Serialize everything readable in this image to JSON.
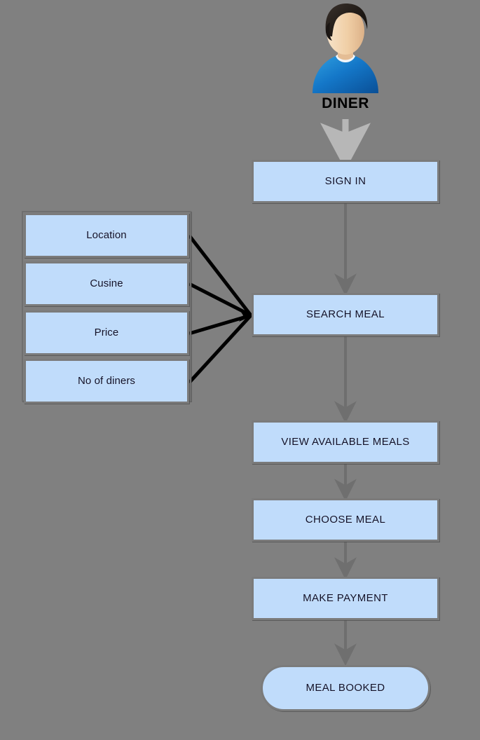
{
  "diagram": {
    "title": "DINER meal booking flowchart",
    "background_color": "#808080",
    "node_fill_color": "#c0dcfb",
    "node_border_color": "#7b7b7b",
    "connector_color": "#6f6f6f",
    "criteria_connector_color": "#000000",
    "actor": {
      "icon": "user-avatar-icon",
      "label": "DINER",
      "hair_color": "#211c19",
      "skin_color": "#f2d2ae",
      "shirt_color": "#1477c8"
    },
    "main_flow": [
      {
        "id": "sign-in",
        "label": "SIGN IN",
        "shape": "rect"
      },
      {
        "id": "search-meal",
        "label": "SEARCH MEAL",
        "shape": "rect"
      },
      {
        "id": "view-available-meals",
        "label": "VIEW AVAILABLE MEALS",
        "shape": "rect"
      },
      {
        "id": "choose-meal",
        "label": "CHOOSE MEAL",
        "shape": "rect"
      },
      {
        "id": "make-payment",
        "label": "MAKE PAYMENT",
        "shape": "rect"
      },
      {
        "id": "meal-booked",
        "label": "MEAL BOOKED",
        "shape": "terminator"
      }
    ],
    "search_criteria": [
      {
        "id": "location",
        "label": "Location"
      },
      {
        "id": "cusine",
        "label": "Cusine"
      },
      {
        "id": "price",
        "label": "Price"
      },
      {
        "id": "no-of-diners",
        "label": "No of diners"
      }
    ],
    "connections": [
      {
        "from": "DINER",
        "to": "SIGN IN",
        "style": "thick-arrow"
      },
      {
        "from": "SIGN IN",
        "to": "SEARCH MEAL",
        "style": "arrow"
      },
      {
        "from": "Location",
        "to": "SEARCH MEAL",
        "style": "line"
      },
      {
        "from": "Cusine",
        "to": "SEARCH MEAL",
        "style": "line"
      },
      {
        "from": "Price",
        "to": "SEARCH MEAL",
        "style": "line"
      },
      {
        "from": "No of diners",
        "to": "SEARCH MEAL",
        "style": "line"
      },
      {
        "from": "SEARCH MEAL",
        "to": "VIEW AVAILABLE MEALS",
        "style": "arrow"
      },
      {
        "from": "VIEW AVAILABLE MEALS",
        "to": "CHOOSE MEAL",
        "style": "arrow"
      },
      {
        "from": "CHOOSE MEAL",
        "to": "MAKE PAYMENT",
        "style": "arrow"
      },
      {
        "from": "MAKE PAYMENT",
        "to": "MEAL BOOKED",
        "style": "arrow"
      }
    ]
  }
}
